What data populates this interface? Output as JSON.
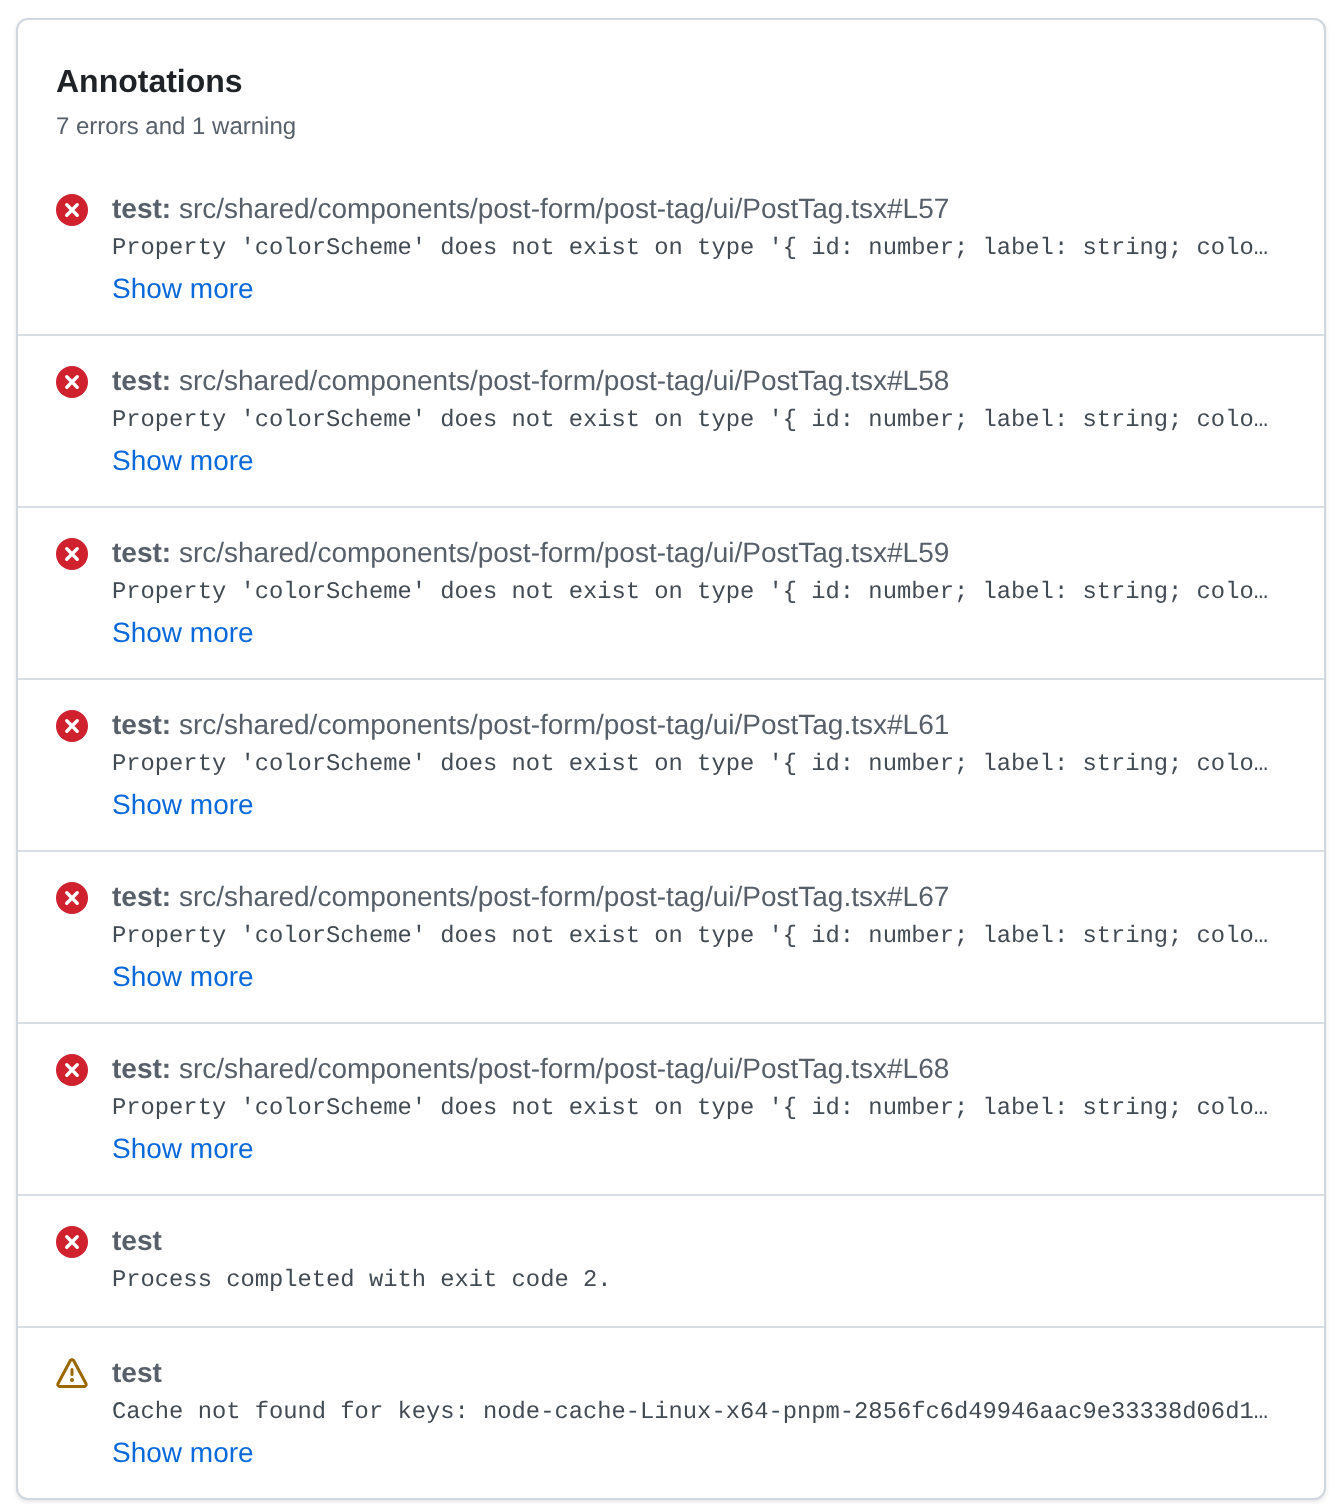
{
  "panel": {
    "title": "Annotations",
    "summary": "7 errors and 1 warning"
  },
  "annotations": [
    {
      "kind": "error",
      "job": "test:",
      "path": "src/shared/components/post-form/post-tag/ui/PostTag.tsx#L57",
      "message": "Property 'colorScheme' does not exist on type '{ id: number; label: string; colo…",
      "action": "Show more"
    },
    {
      "kind": "error",
      "job": "test:",
      "path": "src/shared/components/post-form/post-tag/ui/PostTag.tsx#L58",
      "message": "Property 'colorScheme' does not exist on type '{ id: number; label: string; colo…",
      "action": "Show more"
    },
    {
      "kind": "error",
      "job": "test:",
      "path": "src/shared/components/post-form/post-tag/ui/PostTag.tsx#L59",
      "message": "Property 'colorScheme' does not exist on type '{ id: number; label: string; colo…",
      "action": "Show more"
    },
    {
      "kind": "error",
      "job": "test:",
      "path": "src/shared/components/post-form/post-tag/ui/PostTag.tsx#L61",
      "message": "Property 'colorScheme' does not exist on type '{ id: number; label: string; colo…",
      "action": "Show more"
    },
    {
      "kind": "error",
      "job": "test:",
      "path": "src/shared/components/post-form/post-tag/ui/PostTag.tsx#L67",
      "message": "Property 'colorScheme' does not exist on type '{ id: number; label: string; colo…",
      "action": "Show more"
    },
    {
      "kind": "error",
      "job": "test:",
      "path": "src/shared/components/post-form/post-tag/ui/PostTag.tsx#L68",
      "message": "Property 'colorScheme' does not exist on type '{ id: number; label: string; colo…",
      "action": "Show more"
    },
    {
      "kind": "error",
      "job": "test",
      "message": "Process completed with exit code 2."
    },
    {
      "kind": "warning",
      "job": "test",
      "message": "Cache not found for keys: node-cache-Linux-x64-pnpm-2856fc6d49946aac9e33338d06d1…",
      "action": "Show more"
    }
  ]
}
